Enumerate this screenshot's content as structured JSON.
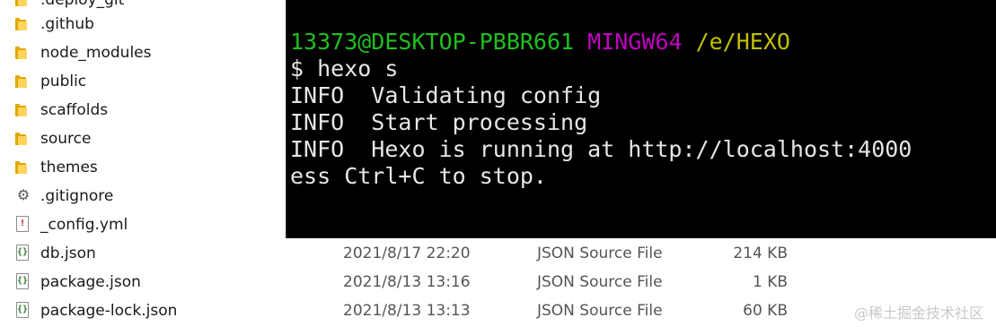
{
  "files": [
    {
      "name": ".deploy_git",
      "icon": "folder-icon",
      "kind": "folder"
    },
    {
      "name": ".github",
      "icon": "folder-icon",
      "kind": "folder"
    },
    {
      "name": "node_modules",
      "icon": "folder-icon",
      "kind": "folder"
    },
    {
      "name": "public",
      "icon": "folder-icon",
      "kind": "folder"
    },
    {
      "name": "scaffolds",
      "icon": "folder-icon",
      "kind": "folder"
    },
    {
      "name": "source",
      "icon": "folder-icon",
      "kind": "folder"
    },
    {
      "name": "themes",
      "icon": "folder-icon",
      "kind": "folder"
    },
    {
      "name": ".gitignore",
      "icon": "gear-icon",
      "kind": "config"
    },
    {
      "name": "_config.yml",
      "icon": "yml-file-icon",
      "kind": "yml"
    },
    {
      "name": "db.json",
      "icon": "json-file-icon",
      "kind": "json",
      "date": "2021/8/17 22:20",
      "type": "JSON Source File",
      "size": "214 KB"
    },
    {
      "name": "package.json",
      "icon": "json-file-icon",
      "kind": "json",
      "date": "2021/8/13 13:16",
      "type": "JSON Source File",
      "size": "1 KB"
    },
    {
      "name": "package-lock.json",
      "icon": "json-file-icon",
      "kind": "json",
      "date": "2021/8/13 13:13",
      "type": "JSON Source File",
      "size": "60 KB"
    }
  ],
  "terminal": {
    "prompt_user": "13373@DESKTOP-PBBR661",
    "prompt_env": "MINGW64",
    "prompt_path": "/e/HEXO",
    "command": "$ hexo s",
    "lines": [
      "INFO  Validating config",
      "INFO  Start processing",
      "INFO  Hexo is running at http://localhost:4000",
      "ess Ctrl+C to stop."
    ]
  },
  "watermark": "@稀土掘金技术社区",
  "colors": {
    "terminal_bg": "#000000",
    "prompt_user": "#20c020",
    "prompt_env": "#c000c0",
    "prompt_path": "#c0c000",
    "folder": "#ffd35c"
  }
}
